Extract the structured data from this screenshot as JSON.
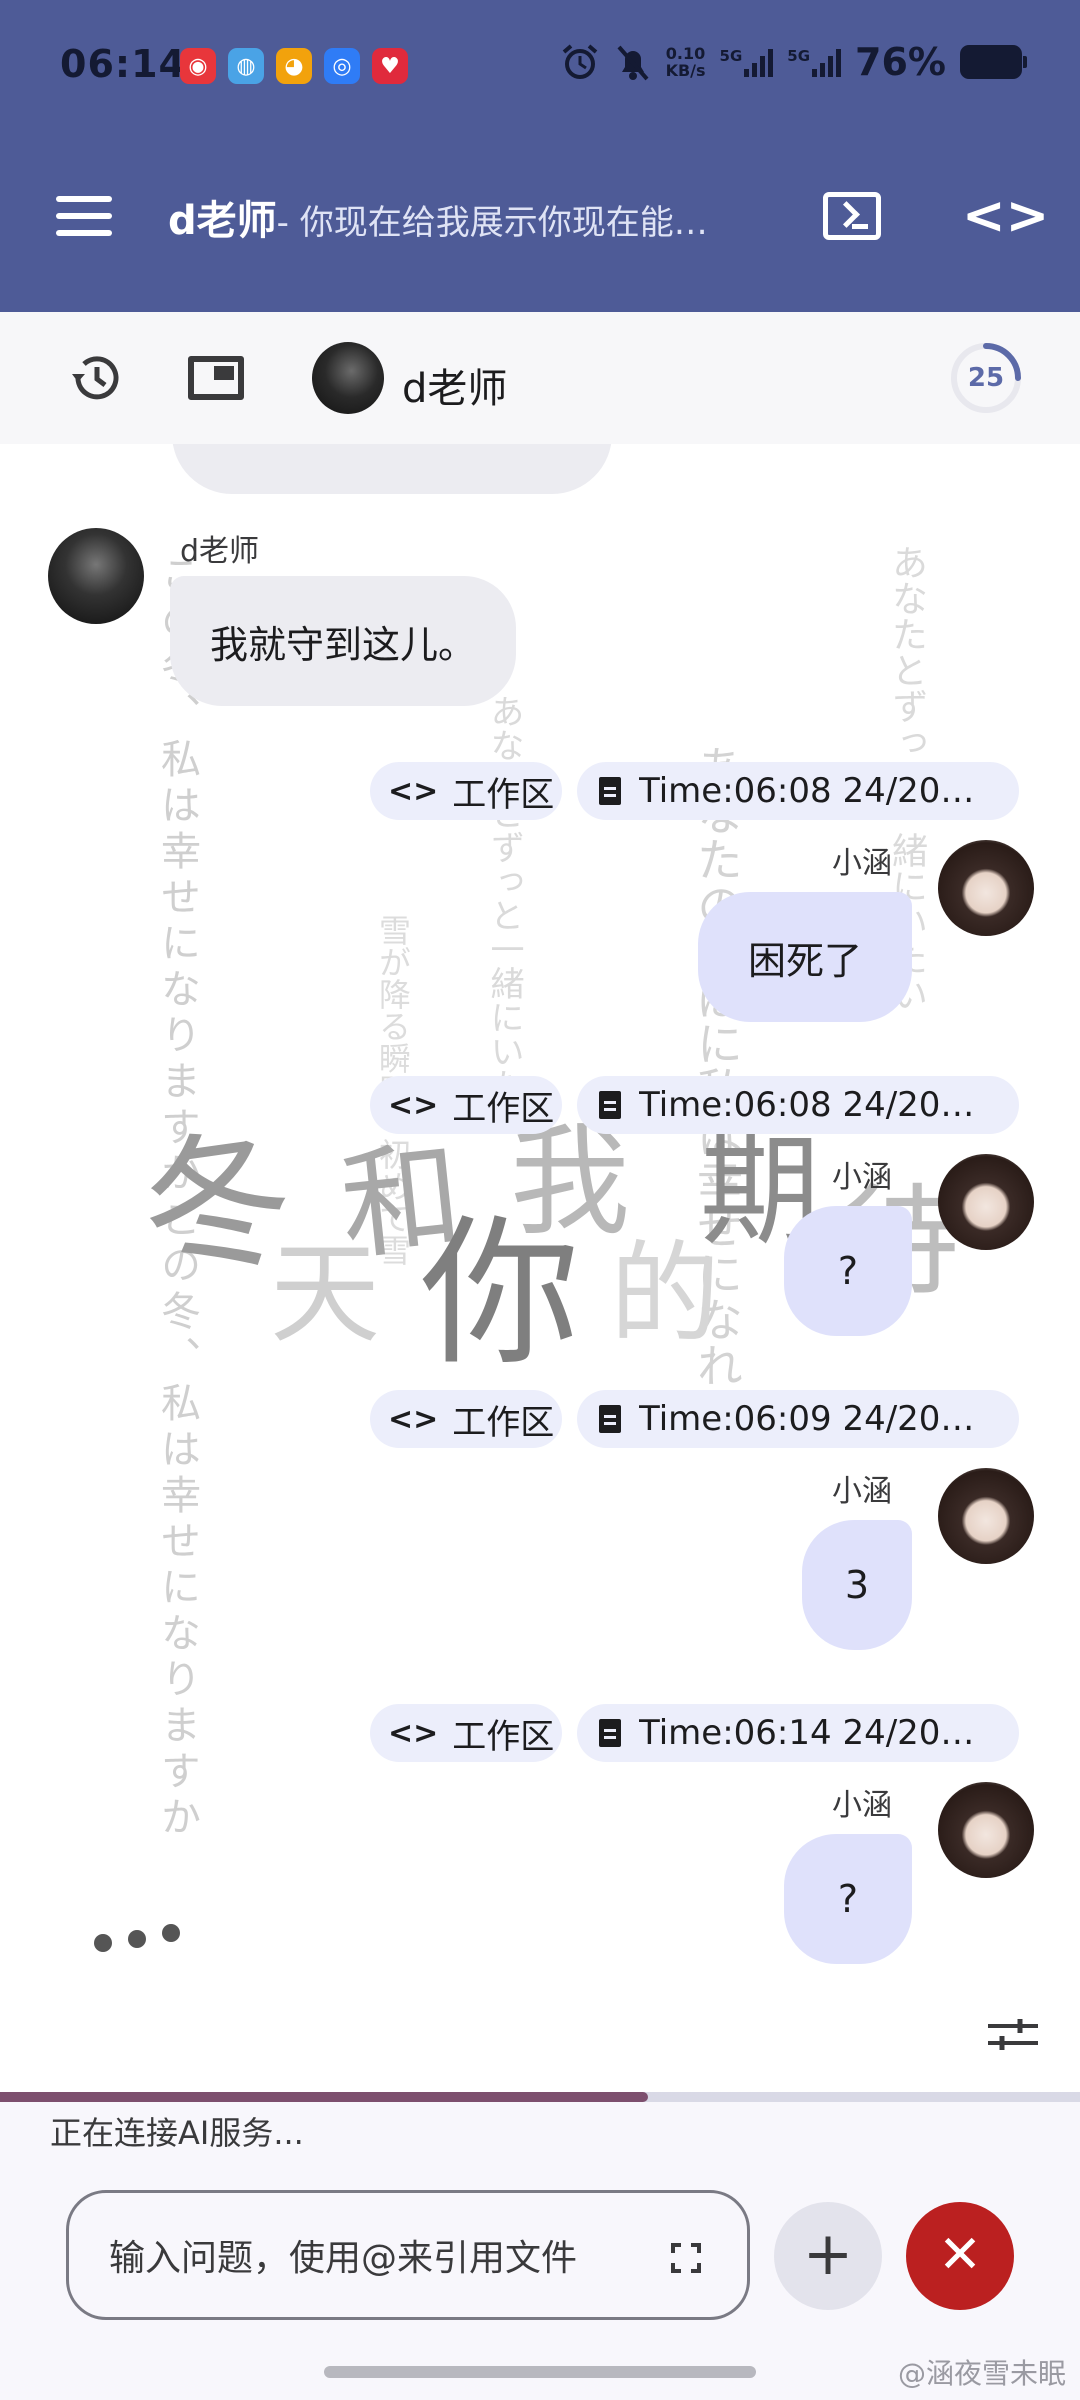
{
  "status_bar": {
    "time": "06:14",
    "net_speed": "0.10",
    "net_unit": "KB/s",
    "signal_1": "5G",
    "signal_2": "5G",
    "battery": "76%",
    "app_icons": [
      "netease-music-icon",
      "browser-icon",
      "weibo-icon",
      "app-icon",
      "music-app-icon"
    ]
  },
  "topbar": {
    "title": "d老师",
    "subtitle": "- 你现在给我展示你现在能…",
    "icons": [
      "menu-icon",
      "terminal-icon",
      "code-icon"
    ]
  },
  "subbar": {
    "name": "d老师",
    "counter": "25"
  },
  "messages": [
    {
      "role": "bot",
      "sender": "d老师",
      "text": "我就守到这儿。"
    },
    {
      "role": "user",
      "sender": "小涵",
      "chip_workspace": "工作区",
      "chip_time": "Time:06:08 24/20…",
      "text": "困死了"
    },
    {
      "role": "user",
      "sender": "小涵",
      "chip_workspace": "工作区",
      "chip_time": "Time:06:08 24/20…",
      "text": "?"
    },
    {
      "role": "user",
      "sender": "小涵",
      "chip_workspace": "工作区",
      "chip_time": "Time:06:09 24/20…",
      "text": "3"
    },
    {
      "role": "user",
      "sender": "小涵",
      "chip_workspace": "工作区",
      "chip_time": "Time:06:14 24/20…",
      "text": "?"
    }
  ],
  "background_art": {
    "col1": "この冬、私は幸せになりますかこの冬、私は幸せになりますか",
    "col2": "あなたとずっと一緒にいたい",
    "col3": "雪が降る瞬間・初めて雪",
    "col4": "あなたのそばに私は幸せになれ",
    "col5": "あなたとずっと一緒にいたい",
    "big": [
      "冬",
      "天",
      "和",
      "你",
      "我",
      "的",
      "期",
      "待"
    ]
  },
  "footer": {
    "status": "正在连接AI服务...",
    "progress": 0.6,
    "placeholder": "输入问题，使用@来引用文件",
    "add_label": "+",
    "close_label": "✕",
    "watermark": "@涵夜雪未眠"
  },
  "colors": {
    "appbar": "#4e5b97",
    "bubble_user": "#dfe1fb",
    "bubble_bot": "#ececf1",
    "close_button": "#bb2020",
    "progress": "#7d4f6e"
  }
}
